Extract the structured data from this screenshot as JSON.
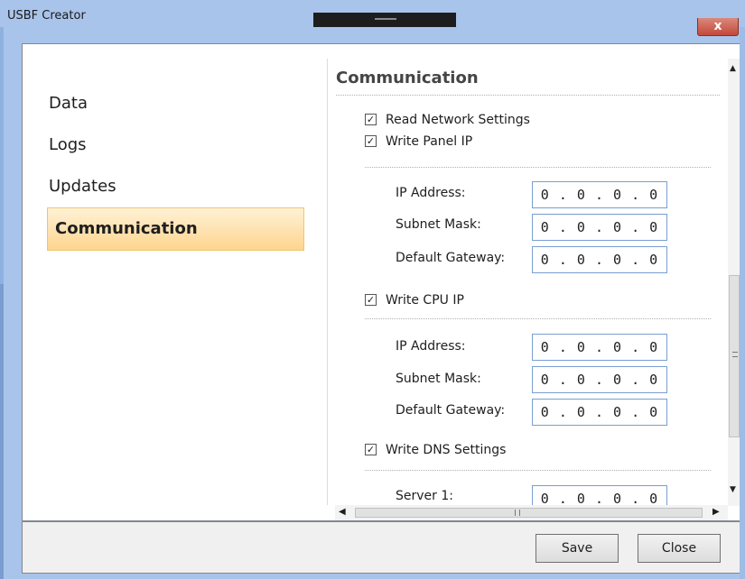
{
  "window": {
    "title": "USBF Creator",
    "close_glyph": "x"
  },
  "sidebar": {
    "items": [
      {
        "label": "Data",
        "selected": false
      },
      {
        "label": "Logs",
        "selected": false
      },
      {
        "label": "Updates",
        "selected": false
      },
      {
        "label": "Communication",
        "selected": true
      }
    ]
  },
  "content": {
    "title": "Communication",
    "read_network": {
      "label": "Read Network Settings",
      "checked": true,
      "mark": "✓"
    },
    "panel": {
      "label": "Write Panel IP",
      "checked": true,
      "mark": "✓",
      "fields": [
        {
          "label": "IP Address:",
          "value": "0 . 0 . 0 . 0"
        },
        {
          "label": "Subnet Mask:",
          "value": "0 . 0 . 0 . 0"
        },
        {
          "label": "Default Gateway:",
          "value": "0 . 0 . 0 . 0"
        }
      ]
    },
    "cpu": {
      "label": "Write CPU IP",
      "checked": true,
      "mark": "✓",
      "fields": [
        {
          "label": "IP Address:",
          "value": "0 . 0 . 0 . 0"
        },
        {
          "label": "Subnet Mask:",
          "value": "0 . 0 . 0 . 0"
        },
        {
          "label": "Default Gateway:",
          "value": "0 . 0 . 0 . 0"
        }
      ]
    },
    "dns": {
      "label": "Write DNS Settings",
      "checked": true,
      "mark": "✓",
      "fields": [
        {
          "label": "Server 1:",
          "value": "0 . 0 . 0 . 0"
        }
      ]
    }
  },
  "footer": {
    "save_label": "Save",
    "close_label": "Close"
  },
  "colors": {
    "selected_bg": "#fdd58e",
    "title_bar": "#a9c4ea",
    "close_button": "#c4483a"
  }
}
